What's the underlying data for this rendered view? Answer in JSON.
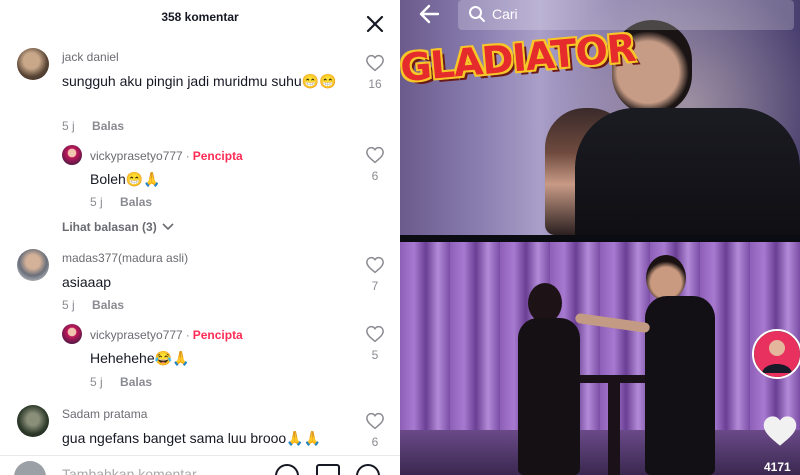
{
  "panel": {
    "title": "358 komentar"
  },
  "comments": [
    {
      "username": "jack daniel",
      "text": "sungguh aku pingin jadi muridmu suhu😁😁",
      "time": "5 j",
      "reply_label": "Balas",
      "likes": "16"
    },
    {
      "username": "vickyprasetyo777",
      "creator_label": "Pencipta",
      "text": "Boleh😁🙏",
      "time": "5 j",
      "reply_label": "Balas",
      "likes": "6"
    },
    {
      "username": "madas377(madura asli)",
      "text": "asiaaap",
      "time": "5 j",
      "reply_label": "Balas",
      "likes": "7"
    },
    {
      "username": "vickyprasetyo777",
      "creator_label": "Pencipta",
      "text": "Hehehehe😂🙏",
      "time": "5 j",
      "reply_label": "Balas",
      "likes": "5"
    },
    {
      "username": "Sadam pratama",
      "text": "gua ngefans banget sama luu brooo🙏🙏",
      "likes": "6"
    }
  ],
  "view_replies": "Lihat balasan (3)",
  "footer": {
    "placeholder": "Tambahkan komentar..."
  },
  "video": {
    "search_placeholder": "Cari",
    "logo_text": "GLADIATOR",
    "like_count": "4171"
  },
  "colors": {
    "accent": "#fe2c55",
    "text": "#161823",
    "muted": "#8a8b91"
  }
}
